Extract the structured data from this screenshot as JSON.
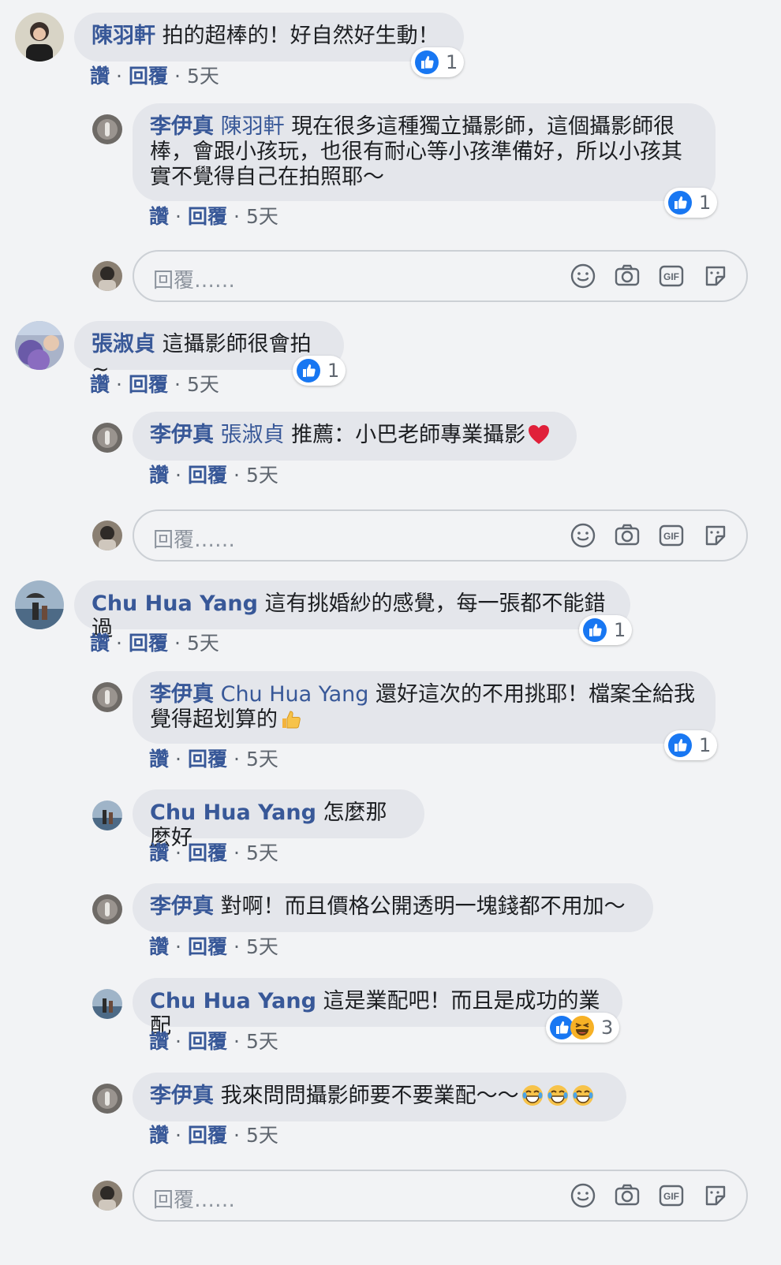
{
  "actions": {
    "like": "讚",
    "reply": "回覆",
    "sep": "·",
    "time": "5天"
  },
  "reply_placeholder": "回覆……",
  "colors": {
    "link": "#385898",
    "like_blue": "#1877f2",
    "bubble": "#e4e6eb"
  },
  "comments": [
    {
      "author": "陳羽軒",
      "text": "拍的超棒的！好自然好生動！",
      "reactions": "1"
    },
    {
      "author": "李伊真",
      "tag": "陳羽軒",
      "text_lines": [
        "現在很多這種獨立攝影師，這個攝影師很",
        "棒，會跟小孩玩，也很有耐心等小孩準備好，所以小孩其",
        "實不覺得自己在拍照耶～"
      ],
      "reactions": "1"
    },
    {
      "author": "張淑貞",
      "text": "這攝影師很會拍~",
      "reactions": "1"
    },
    {
      "author": "李伊真",
      "tag": "張淑貞",
      "text": "推薦：小巴老師專業攝影",
      "emoji": "heart-emoji"
    },
    {
      "author": "Chu Hua Yang",
      "text": "這有挑婚紗的感覺，每一張都不能錯過",
      "reactions": "1"
    },
    {
      "author": "李伊真",
      "tag": "Chu Hua Yang",
      "text_line1": "還好這次的不用挑耶！檔案全給我",
      "text_line2": "覺得超划算的",
      "emoji": "thumbs-up-emoji",
      "reactions": "1"
    },
    {
      "author": "Chu Hua Yang",
      "text": "怎麼那麼好"
    },
    {
      "author": "李伊真",
      "text": "對啊！而且價格公開透明一塊錢都不用加～"
    },
    {
      "author": "Chu Hua Yang",
      "text": "這是業配吧！而且是成功的業配",
      "reactions": "3"
    },
    {
      "author": "李伊真",
      "text": "我來問問攝影師要不要業配～～",
      "emoji": "laughing-emoji"
    }
  ]
}
